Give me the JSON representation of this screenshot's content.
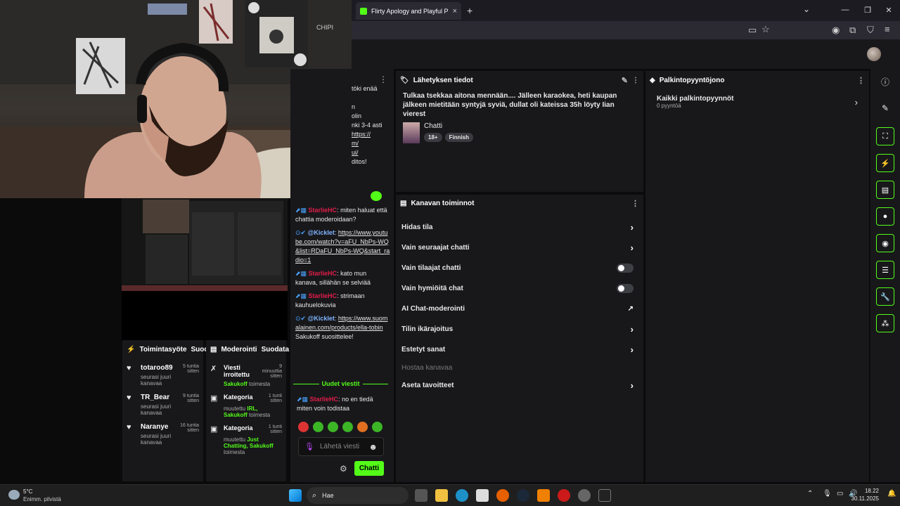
{
  "browser": {
    "tab_title": "Flirty Apology and Playful Plans",
    "tab_close": "×",
    "new_tab": "+",
    "win_min": "—",
    "win_max": "❐",
    "win_close": "✕",
    "chevron": "⌄"
  },
  "stream_info": {
    "header": "Lähetyksen tiedot",
    "title": "Tulkaa tsekkaa aitona mennään.... Jälleen karaokea, heti kaupan jälkeen mietitään syntyjä syviä, dullat oli kateissa 35h löyty Iian vierest",
    "category": "Chatti",
    "tags": [
      "18+",
      "Finnish"
    ]
  },
  "rewards": {
    "header": "Palkintopyyntöjono",
    "item_title": "Kaikki palkintopyynnöt",
    "item_sub": "0 pyyntöä"
  },
  "channel_actions": {
    "header": "Kanavan toiminnot",
    "items": [
      {
        "label": "Hidas tila",
        "kind": "chevron"
      },
      {
        "label": "Vain seuraajat chatti",
        "kind": "chevron"
      },
      {
        "label": "Vain tilaajat chatti",
        "kind": "toggle"
      },
      {
        "label": "Vain hymiöitä chat",
        "kind": "toggle"
      },
      {
        "label": "AI Chat-moderointi",
        "kind": "external"
      },
      {
        "label": "Tilin ikärajoitus",
        "kind": "chevron"
      },
      {
        "label": "Estetyt sanat",
        "kind": "chevron"
      },
      {
        "label": "Hostaa kanavaa",
        "kind": "none"
      },
      {
        "label": "Aseta tavoitteet",
        "kind": "chevron"
      }
    ]
  },
  "activity": {
    "header": "Toimintasyöte",
    "filter": "Suod",
    "items": [
      {
        "name": "totaroo89",
        "time": "5 tuntia sitten",
        "sub": "seurasi juuri kanavaa"
      },
      {
        "name": "TR_Bear",
        "time": "9 tuntia sitten",
        "sub": "seurasi juuri kanavaa"
      },
      {
        "name": "Naranye",
        "time": "16 tuntia sitten",
        "sub": "seurasi juuri kanavaa"
      }
    ]
  },
  "moderation": {
    "header": "Moderointi",
    "filter": "Suodata",
    "items": [
      {
        "title": "Viesti irroitettu",
        "time": "9 minuuttia sitten",
        "pre": "",
        "hl": "Sakukoff",
        "post": " toimesta"
      },
      {
        "title": "Kategoria",
        "time": "1 tunti sitten",
        "pre": "muutettu ",
        "hl": "IRL, Sakukoff",
        "post": " toimesta"
      },
      {
        "title": "Kategoria",
        "time": "1 tunti sitten",
        "pre": "muutettu ",
        "hl": "Just Chatting, Sakukoff",
        "post": " toimesta"
      }
    ]
  },
  "chat": {
    "partial_lines": [
      "töki enää",
      "n",
      "olin",
      "nki 3-4 asti",
      "https://",
      "m/",
      "ui/",
      "ditos!"
    ],
    "messages": [
      {
        "user": "StarlieHC",
        "bot": false,
        "text": ": miten haluat että chattia moderoidaan?"
      },
      {
        "user": "@Kicklet",
        "bot": true,
        "link": "https://www.youtube.com/watch?v=aFU_NbPs-WQ&list=RDaFU_NbPs-WQ&start_radio=1",
        "text": ""
      },
      {
        "user": "StarlieHC",
        "bot": false,
        "text": ": kato mun kanava, sillähän se selviää"
      },
      {
        "user": "StarlieHC",
        "bot": false,
        "text": ": strimaan kauhuelokuvia"
      },
      {
        "user": "@Kicklet",
        "bot": true,
        "link": "https://www.suomalainen.com/products/ella-tobin",
        "text": " Sakukoff suosittelee!"
      }
    ],
    "new_messages": "Uudet viestit",
    "last": {
      "user": "StarlieHC",
      "text": ": no en tiedä miten voin todistaa"
    },
    "input_placeholder": "Lähetä viesti",
    "send": "Chatti"
  },
  "taskbar": {
    "weather_temp": "5°C",
    "weather_desc": "Enimm. pilvistä",
    "search": "Hae",
    "time": "18.22",
    "date": "30.11.2025"
  },
  "colors": {
    "accent": "#53fc18",
    "panel": "#18181b",
    "bg": "#0b0b0c",
    "user": "#e21d48"
  }
}
